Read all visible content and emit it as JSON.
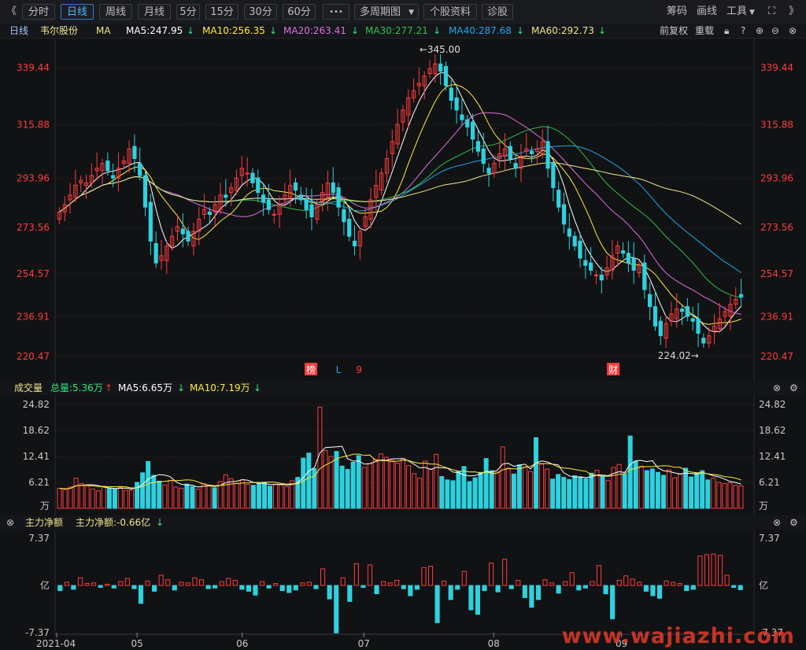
{
  "toolbar": {
    "nav_left": "《",
    "periods": [
      "分时",
      "日线",
      "周线",
      "月线",
      "5分",
      "15分",
      "30分",
      "60分"
    ],
    "active_period": "日线",
    "more": "•••",
    "multi_period": "多周期图",
    "stock_info": "个股资料",
    "diagnose": "诊股",
    "right_items": {
      "chip": "筹码",
      "draw": "画线",
      "tools": "工具",
      "expand": "⛶",
      "nav_right": "》"
    }
  },
  "legend": {
    "period": "日线",
    "stock": "韦尔股份",
    "ma_label": "MA",
    "ma": [
      {
        "label": "MA5:247.95",
        "color": "#ffffff"
      },
      {
        "label": "MA10:256.35",
        "color": "#ffeb3b"
      },
      {
        "label": "MA20:263.41",
        "color": "#e070e0"
      },
      {
        "label": "MA30:277.21",
        "color": "#2fbf4f"
      },
      {
        "label": "MA40:287.68",
        "color": "#1ea7e8"
      },
      {
        "label": "MA60:292.73",
        "color": "#f0e68c"
      }
    ],
    "adjust": "前复权",
    "reload": "重载"
  },
  "price_axis": {
    "ticks": [
      "339.44",
      "315.88",
      "293.96",
      "273.56",
      "254.57",
      "236.91",
      "220.47"
    ]
  },
  "annotations": {
    "high": "←345.00",
    "low": "224.02→",
    "markers": [
      "榜",
      "L",
      "9",
      "财"
    ]
  },
  "volume_panel": {
    "title": "成交量",
    "total": "总量:5.36万",
    "ma5": "MA5:6.65万",
    "ma10": "MA10:7.19万",
    "ticks": [
      "24.82",
      "18.62",
      "12.41",
      "6.21",
      "万"
    ]
  },
  "flow_panel": {
    "title": "主力净额",
    "value": "主力净额:-0.66亿",
    "ticks": [
      "7.37",
      "亿",
      "-7.37"
    ]
  },
  "x_axis": {
    "labels": [
      "2021-04",
      "05",
      "06",
      "07",
      "08",
      "09"
    ]
  },
  "watermark": "www.wajiazhi.com",
  "colors": {
    "up": "#ff3b3b",
    "down": "#2ed1de",
    "background": "#111214",
    "axis_text": "#ff3b3b"
  },
  "chart_data": {
    "type": "candlestick",
    "x_range": [
      "2021-04",
      "2021-09"
    ],
    "y_axis_ticks": [
      339.44,
      315.88,
      293.96,
      273.56,
      254.57,
      236.91,
      220.47
    ],
    "high": 345.0,
    "low": 224.02,
    "close": [
      280,
      283,
      287,
      291,
      293,
      292,
      295,
      298,
      300,
      297,
      294,
      298,
      301,
      306,
      302,
      295,
      282,
      268,
      259,
      262,
      266,
      270,
      274,
      271,
      268,
      272,
      277,
      281,
      279,
      283,
      287,
      286,
      290,
      294,
      298,
      296,
      292,
      288,
      284,
      281,
      279,
      283,
      287,
      291,
      289,
      285,
      281,
      278,
      283,
      288,
      292,
      288,
      282,
      276,
      270,
      266,
      272,
      278,
      285,
      291,
      296,
      302,
      309,
      316,
      322,
      327,
      330,
      333,
      336,
      339,
      341,
      338,
      332,
      326,
      322,
      318,
      315,
      310,
      305,
      300,
      296,
      300,
      304,
      306,
      302,
      298,
      303,
      306,
      304,
      306,
      309,
      298,
      290,
      282,
      275,
      270,
      266,
      261,
      258,
      256,
      254,
      252,
      257,
      262,
      266,
      263,
      259,
      256,
      258,
      248,
      241,
      233,
      229,
      234,
      238,
      240,
      239,
      237,
      235,
      230,
      226,
      229,
      233,
      236,
      239,
      242,
      244,
      245
    ],
    "ma": {
      "MA5": 247.95,
      "MA10": 256.35,
      "MA20": 263.41,
      "MA30": 277.21,
      "MA40": 287.68,
      "MA60": 292.73
    },
    "volume": [
      4.8,
      4.5,
      5.1,
      7.2,
      5.9,
      5.4,
      4.6,
      4.2,
      5.3,
      4.9,
      4.7,
      5.0,
      4.3,
      4.4,
      6.2,
      8.5,
      11.2,
      7.9,
      6.5,
      5.6,
      6.7,
      5.1,
      4.8,
      5.8,
      5.2,
      4.6,
      5.9,
      5.5,
      4.9,
      6.4,
      8.0,
      7.1,
      6.0,
      6.8,
      5.7,
      5.5,
      5.9,
      6.1,
      5.3,
      5.8,
      5.6,
      5.2,
      6.6,
      7.4,
      12.0,
      13.2,
      9.5,
      24.2,
      13.8,
      12.4,
      13.6,
      10.1,
      9.3,
      11.0,
      12.6,
      9.8,
      10.7,
      11.7,
      13.0,
      12.2,
      11.5,
      10.8,
      11.9,
      10.2,
      8.3,
      7.2,
      11.3,
      9.4,
      12.9,
      7.6,
      6.8,
      6.6,
      8.9,
      10.0,
      6.4,
      7.3,
      8.6,
      11.9,
      9.0,
      8.7,
      14.7,
      9.6,
      8.2,
      10.4,
      9.9,
      8.8,
      16.9,
      10.6,
      9.4,
      7.0,
      8.1,
      7.4,
      6.9,
      7.8,
      7.5,
      7.1,
      8.4,
      9.1,
      7.7,
      6.7,
      9.8,
      10.5,
      8.2,
      17.3,
      11.2,
      10.1,
      9.0,
      9.4,
      8.6,
      7.9,
      9.2,
      7.3,
      8.1,
      9.6,
      7.5,
      8.4,
      9.0,
      6.8,
      7.2,
      6.2,
      5.9,
      6.1,
      5.5,
      5.36
    ],
    "volume_ma": {
      "MA5": 6.65,
      "MA10": 7.19
    },
    "volume_ticks": [
      24.82,
      18.62,
      12.41,
      6.21
    ],
    "main_flow": [
      -0.8,
      0.5,
      -0.6,
      1.2,
      0.3,
      0.4,
      -0.3,
      0.2,
      -0.4,
      0.6,
      1.1,
      -0.5,
      -2.8,
      0.7,
      -0.9,
      1.6,
      0.9,
      -0.7,
      0.5,
      0.4,
      1.2,
      0.9,
      -0.5,
      -0.4,
      0.6,
      1.1,
      0.8,
      -0.6,
      -0.9,
      -1.5,
      0.6,
      -0.4,
      0.3,
      -0.8,
      -1.1,
      -0.7,
      0.4,
      0.5,
      -0.5,
      2.6,
      -2.1,
      -7.4,
      1.2,
      -2.5,
      3.4,
      -0.3,
      3.2,
      -1.3,
      0.6,
      0.4,
      0.8,
      -0.5,
      -1.6,
      -0.6,
      2.8,
      3.0,
      -5.8,
      0.7,
      -2.2,
      -0.6,
      2.2,
      -3.8,
      -4.5,
      -0.8,
      3.5,
      -1.0,
      4.1,
      -0.5,
      0.8,
      -1.9,
      -3.4,
      -2.2,
      0.9,
      0.4,
      -1.2,
      0.6,
      2.0,
      -0.7,
      -0.4,
      0.6,
      3.1,
      -1.3,
      -5.2,
      0.8,
      1.5,
      1.0,
      0.5,
      -0.9,
      -1.6,
      -2.0,
      0.7,
      0.5,
      0.3,
      -0.8,
      -0.6,
      4.6,
      4.8,
      4.9,
      4.7,
      1.6,
      -0.3,
      -0.66
    ],
    "main_flow_ticks": [
      7.37,
      -7.37
    ]
  }
}
